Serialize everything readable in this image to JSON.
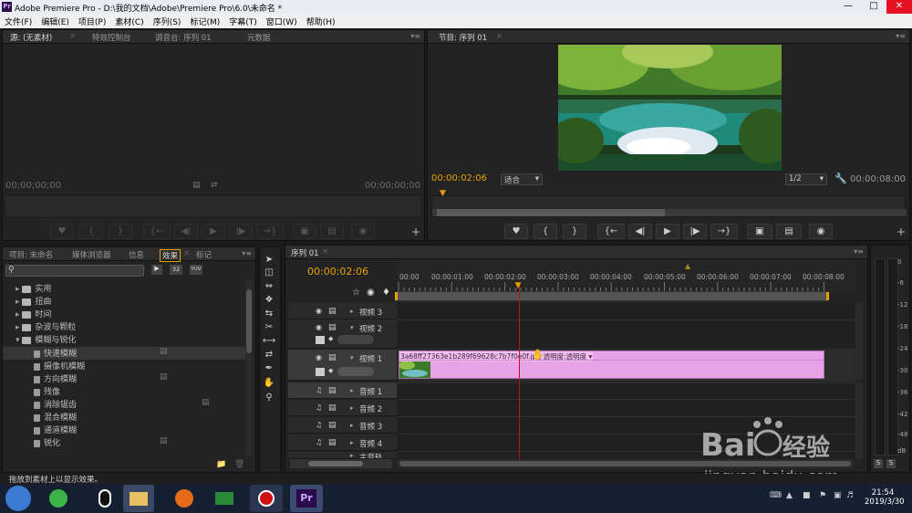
{
  "window": {
    "title": "Adobe Premiere Pro - D:\\我的文档\\Adobe\\Premiere Pro\\6.0\\未命名 *",
    "app_icon": "Pr"
  },
  "menu": [
    "文件(F)",
    "编辑(E)",
    "项目(P)",
    "素材(C)",
    "序列(S)",
    "标记(M)",
    "字幕(T)",
    "窗口(W)",
    "帮助(H)"
  ],
  "source_panel": {
    "tabs": [
      "源: (无素材)",
      "特效控制台",
      "调音台: 序列 01",
      "元数据"
    ],
    "tc_left": "00;00;00;00",
    "tc_right": "00;00;00;00"
  },
  "program_panel": {
    "tab": "节目: 序列 01",
    "timecode": "00:00:02:06",
    "fit": "适合",
    "resolution": "1/2",
    "duration": "00:00:08:00"
  },
  "project_panel": {
    "tabs": [
      "项目: 未命名",
      "媒体浏览器",
      "信息",
      "效果",
      "标记"
    ],
    "search_placeholder": "",
    "badges": [
      "32",
      "YUV"
    ],
    "tree": [
      {
        "label": "实用",
        "level": 1
      },
      {
        "label": "扭曲",
        "level": 1
      },
      {
        "label": "时间",
        "level": 1
      },
      {
        "label": "杂波与颗粒",
        "level": 1
      },
      {
        "label": "模糊与锐化",
        "level": 1
      },
      {
        "label": "快速模糊",
        "level": 2
      },
      {
        "label": "摄像机模糊",
        "level": 2
      },
      {
        "label": "方向模糊",
        "level": 2
      },
      {
        "label": "残像",
        "level": 2
      },
      {
        "label": "消除锯齿",
        "level": 2
      },
      {
        "label": "混合模糊",
        "level": 2
      },
      {
        "label": "通道模糊",
        "level": 2
      },
      {
        "label": "锐化",
        "level": 2
      }
    ]
  },
  "timeline": {
    "tab": "序列 01",
    "timecode": "00:00:02:06",
    "ruler": [
      "00:00",
      "00:00:01:00",
      "00:00:02:00",
      "00:00:03:00",
      "00:00:04:00",
      "00:00:05:00",
      "00:00:06:00",
      "00:00:07:00",
      "00:00:08:00"
    ],
    "tracks": {
      "v3": "视频 3",
      "v2": "视频 2",
      "v1": "视频 1",
      "a1": "音频 1",
      "a2": "音频 2",
      "a3": "音频 3",
      "a4": "音频 4",
      "master": "主音轨"
    },
    "clip_name": "3a68ff27363e1b289f69628c7b7f0e0f.jpg",
    "clip_fx": "透明度:透明度",
    "playhead_fraction": 0.2825
  },
  "meters": {
    "labels": [
      "0",
      "-6",
      "-12",
      "-18",
      "-24",
      "-30",
      "-36",
      "-42",
      "-48",
      "dB"
    ],
    "solo": [
      "S",
      "S"
    ]
  },
  "status": {
    "text": "拖放到素材上以显示效果。"
  },
  "taskbar": {
    "time": "21:54",
    "date": "2019/3/30",
    "pr_label": "Pr"
  },
  "colors": {
    "accent_timecode": "#e8a000",
    "clip_pink": "#e6a3e6",
    "playhead_red": "#c01010"
  }
}
